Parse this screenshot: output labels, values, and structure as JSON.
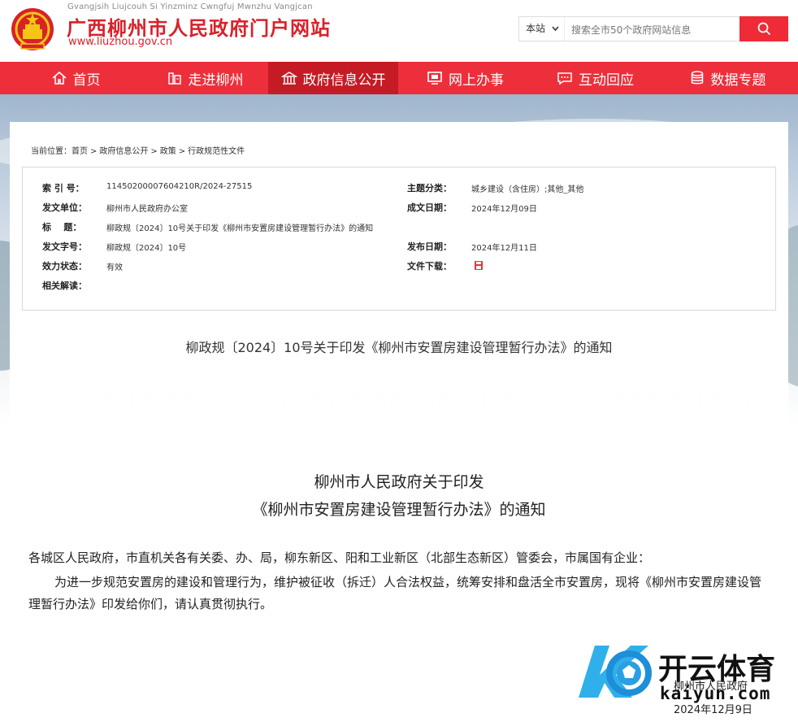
{
  "header": {
    "pinyin": "Gvangjsih Liujcouh Si Yinzminz Cwngfuj Mwnzhu Vangjcan",
    "title": "广西柳州市人民政府门户网站",
    "url": "www.liuzhou.gov.cn",
    "search": {
      "scope": "本站",
      "placeholder": "搜索全市50个政府网站信息"
    }
  },
  "nav": {
    "items": [
      {
        "label": "首页",
        "icon": "home-icon"
      },
      {
        "label": "走进柳州",
        "icon": "city-icon"
      },
      {
        "label": "政府信息公开",
        "icon": "government-icon",
        "active": true
      },
      {
        "label": "网上办事",
        "icon": "monitor-icon"
      },
      {
        "label": "互动回应",
        "icon": "chat-icon"
      },
      {
        "label": "数据专题",
        "icon": "database-icon"
      }
    ]
  },
  "breadcrumb": {
    "prefix": "当前位置：",
    "items": [
      "首页",
      "政府信息公开",
      "政策",
      "行政规范性文件"
    ],
    "separator": ">"
  },
  "info": {
    "index_label": "索 引 号：",
    "index_value": "11450200007604210R/2024-27515",
    "category_label": "主题分类：",
    "category_value": "城乡建设（含住房）;其他_其他",
    "issuer_label": "发文单位：",
    "issuer_value": "柳州市人民政府办公室",
    "created_label": "成文日期：",
    "created_value": "2024年12月09日",
    "title_label": "标    题：",
    "title_value": "柳政规〔2024〕10号关于印发《柳州市安置房建设管理暂行办法》的通知",
    "docno_label": "发文字号：",
    "docno_value": "柳政规〔2024〕10号",
    "published_label": "发布日期：",
    "published_value": "2024年12月11日",
    "status_label": "效力状态：",
    "status_value": "有效",
    "download_label": "文件下载：",
    "related_label": "相关解读："
  },
  "document": {
    "heading": "柳政规〔2024〕10号关于印发《柳州市安置房建设管理暂行办法》的通知",
    "title_line1": "柳州市人民政府关于印发",
    "title_line2": "《柳州市安置房建设管理暂行办法》的通知",
    "salutation": "各城区人民政府，市直机关各有关委、办、局，柳东新区、阳和工业新区（北部生态新区）管委会，市属国有企业：",
    "paragraph": "为进一步规范安置房的建设和管理行为，维护被征收（拆迁）人合法权益，统筹安排和盘活全市安置房，现将《柳州市安置房建设管理暂行办法》印发给你们，请认真贯彻执行。",
    "signature": "柳州市人民政府",
    "date": "2024年12月9日"
  },
  "watermark": {
    "brand": "开云体育",
    "domain": "kaiyun.com"
  },
  "colors": {
    "brand_red": "#d9212a",
    "nav_red": "#ed2f3c",
    "nav_active": "#c51b25"
  }
}
